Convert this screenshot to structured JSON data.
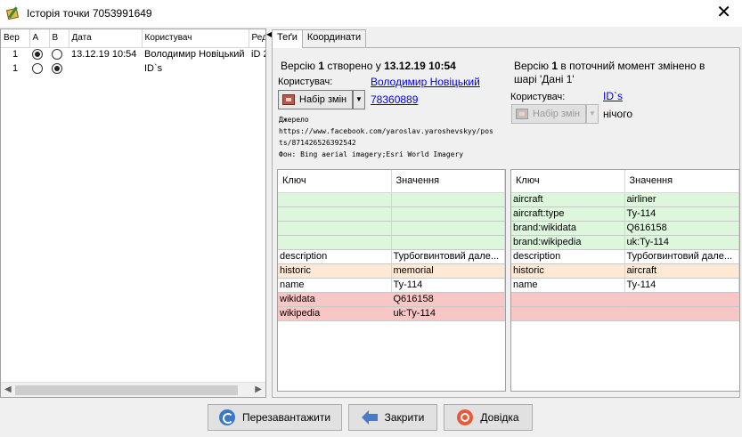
{
  "window": {
    "title": "Історія точки 7053991649",
    "close_glyph": "✕"
  },
  "history": {
    "columns": [
      "Вер",
      "A",
      "B",
      "Дата",
      "Користувач",
      "Ред"
    ],
    "rows": [
      {
        "version": "1",
        "a_selected": true,
        "b_selected": false,
        "date": "13.12.19 10:54",
        "user": "Володимир Новіцький",
        "editor": "iD 2"
      },
      {
        "version": "1",
        "a_selected": false,
        "b_selected": true,
        "date": "",
        "user": "ID`s",
        "editor": ""
      }
    ]
  },
  "tabs": [
    {
      "label": "Теґи",
      "active": true
    },
    {
      "label": "Координати",
      "active": false
    }
  ],
  "left_version": {
    "prefix": "Версію ",
    "number": "1",
    "middle": " створено у ",
    "timestamp": "13.12.19 10:54",
    "user_label": "Користувач:",
    "user_link": "Володимир Новіцький",
    "changeset_link": "78360889",
    "changeset_button": "Набір змін",
    "source_label": "Джерело",
    "source_value_line1": "https://www.facebook.com/yaroslav.yaroshevskyy/pos",
    "source_value_line2": "ts/871426526392542",
    "imagery": "Фон: Bing aerial imagery;Esri World Imagery"
  },
  "right_version": {
    "line1_prefix": "Версію ",
    "number": "1",
    "line1_suffix": " в поточний момент змінено в",
    "line2": "шарі 'Дані 1'",
    "user_label": "Користувач:",
    "user_link": "ID`s",
    "changeset_button": "Набір змін",
    "changeset_value": "нічого"
  },
  "tag_headers": {
    "key": "Ключ",
    "value": "Значення"
  },
  "left_tags": [
    {
      "key": "",
      "value": "",
      "status": "added"
    },
    {
      "key": "",
      "value": "",
      "status": "added"
    },
    {
      "key": "",
      "value": "",
      "status": "added"
    },
    {
      "key": "",
      "value": "",
      "status": "added"
    },
    {
      "key": "description",
      "value": "Турбогвинтовий дале...",
      "status": "unchanged"
    },
    {
      "key": "historic",
      "value": "memorial",
      "status": "changed"
    },
    {
      "key": "name",
      "value": "Ту-114",
      "status": "unchanged"
    },
    {
      "key": "wikidata",
      "value": "Q616158",
      "status": "deleted"
    },
    {
      "key": "wikipedia",
      "value": "uk:Ту-114",
      "status": "deleted"
    }
  ],
  "right_tags": [
    {
      "key": "aircraft",
      "value": "airliner",
      "status": "added"
    },
    {
      "key": "aircraft:type",
      "value": "Ту-114",
      "status": "added"
    },
    {
      "key": "brand:wikidata",
      "value": "Q616158",
      "status": "added"
    },
    {
      "key": "brand:wikipedia",
      "value": "uk:Ту-114",
      "status": "added"
    },
    {
      "key": "description",
      "value": "Турбогвинтовий дале...",
      "status": "unchanged"
    },
    {
      "key": "historic",
      "value": "aircraft",
      "status": "changed"
    },
    {
      "key": "name",
      "value": "Ту-114",
      "status": "unchanged"
    },
    {
      "key": "",
      "value": "",
      "status": "deleted"
    },
    {
      "key": "",
      "value": "",
      "status": "deleted"
    }
  ],
  "buttons": {
    "reload": "Перезавантажити",
    "close": "Закрити",
    "help": "Довідка"
  },
  "colors": {
    "added": "#ddf7dd",
    "changed": "#ffe8d4",
    "deleted": "#f9c6c6",
    "link": "#0000ee"
  }
}
